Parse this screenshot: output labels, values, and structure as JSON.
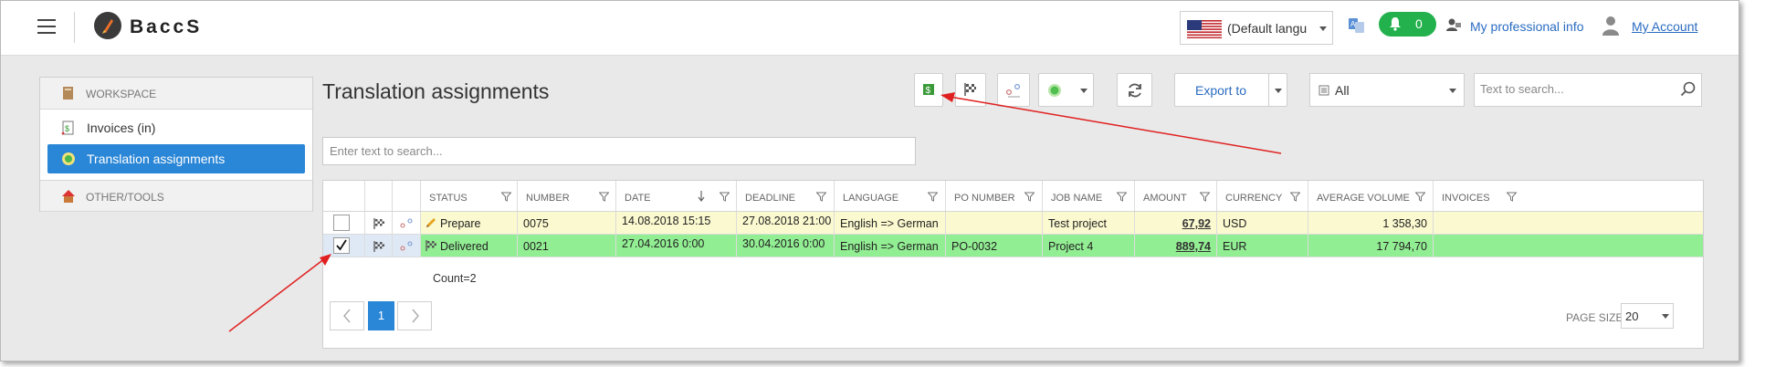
{
  "app": {
    "brand": "BaccS"
  },
  "topbar": {
    "language": "(Default langu",
    "notifications_count": "0",
    "professional_info": "My professional info",
    "my_account": "My Account"
  },
  "sidebar": {
    "workspace": "WORKSPACE",
    "items": [
      {
        "label": "Invoices (in)"
      },
      {
        "label": "Translation assignments"
      }
    ],
    "other_tools": "OTHER/TOOLS"
  },
  "main": {
    "title": "Translation assignments",
    "export_label": "Export to",
    "filter_value": "All",
    "top_search_placeholder": "Text to search...",
    "grid_search_placeholder": "Enter text to search..."
  },
  "table": {
    "columns": [
      "STATUS",
      "NUMBER",
      "DATE",
      "DEADLINE",
      "LANGUAGE",
      "PO NUMBER",
      "JOB NAME",
      "AMOUNT",
      "CURRENCY",
      "AVERAGE VOLUME",
      "INVOICES"
    ],
    "rows": [
      {
        "checked": false,
        "status": "Prepare",
        "number": "0075",
        "date": "14.08.2018 15:15",
        "deadline": "27.08.2018 21:00",
        "language": "English => German",
        "po_number": "",
        "job_name": "Test project",
        "amount": "67,92",
        "currency": "USD",
        "average_volume": "1 358,30",
        "invoices": ""
      },
      {
        "checked": true,
        "status": "Delivered",
        "number": "0021",
        "date": "27.04.2016 0:00",
        "deadline": "30.04.2016 0:00",
        "language": "English => German",
        "po_number": "PO-0032",
        "job_name": "Project 4",
        "amount": "889,74",
        "currency": "EUR",
        "average_volume": "17 794,70",
        "invoices": ""
      }
    ],
    "count_label": "Count=2"
  },
  "pager": {
    "current_page": "1",
    "page_size_label": "PAGE SIZE",
    "page_size": "20"
  },
  "colors": {
    "accent": "#2a86d6",
    "row_prepare": "#fbf9cf",
    "row_delivered": "#92ee93",
    "notification": "#23b14d",
    "annotation_arrow": "#e02020"
  }
}
